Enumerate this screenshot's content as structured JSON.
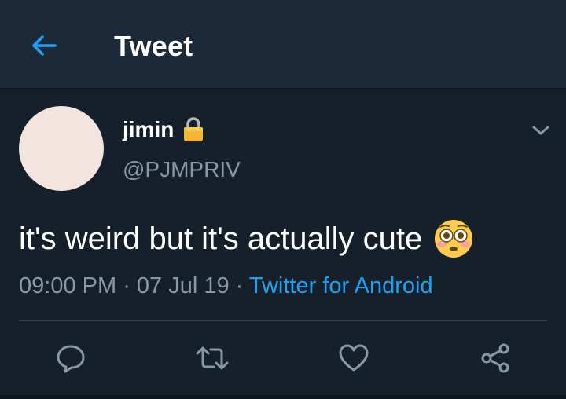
{
  "header": {
    "title": "Tweet"
  },
  "tweet": {
    "author_name": "jimin",
    "author_handle": "@PJMPRIV",
    "text": "it's weird but it's actually cute",
    "time": "09:00 PM",
    "separator": " · ",
    "date": "07 Jul 19",
    "source": "Twitter for Android"
  },
  "icons": {
    "back": "back-arrow-icon",
    "lock": "lock-icon",
    "caret": "chevron-down-icon",
    "emoji": "flushed-face-emoji",
    "reply": "reply-icon",
    "retweet": "retweet-icon",
    "like": "heart-icon",
    "share": "share-icon"
  },
  "colors": {
    "background": "#15202b",
    "header": "#1c2938",
    "accent": "#1da1f2",
    "secondary_text": "#8899a6"
  }
}
